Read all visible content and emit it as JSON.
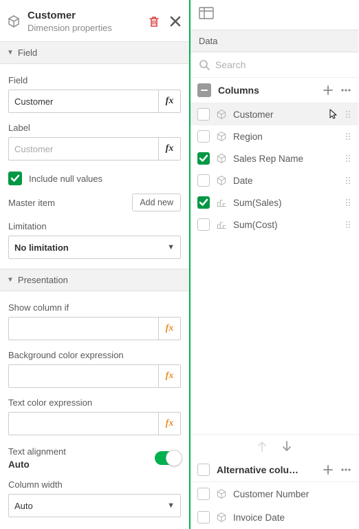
{
  "header": {
    "title": "Customer",
    "subtitle": "Dimension properties"
  },
  "sections": {
    "field": "Field",
    "presentation": "Presentation"
  },
  "field": {
    "label": "Field",
    "value": "Customer",
    "label_label": "Label",
    "label_placeholder": "Customer",
    "include_null": "Include null values",
    "master_item": "Master item",
    "add_new": "Add new",
    "limitation_label": "Limitation",
    "limitation_value": "No limitation"
  },
  "presentation": {
    "show_if": "Show column if",
    "bg_expr": "Background color expression",
    "text_expr": "Text color expression",
    "text_align_label": "Text alignment",
    "text_align_value": "Auto",
    "col_width_label": "Column width",
    "col_width_value": "Auto"
  },
  "right": {
    "data": "Data",
    "search_placeholder": "Search",
    "columns_title": "Columns",
    "columns": [
      {
        "name": "Customer",
        "type": "dim",
        "checked": false,
        "hovered": true
      },
      {
        "name": "Region",
        "type": "dim",
        "checked": false
      },
      {
        "name": "Sales Rep Name",
        "type": "dim",
        "checked": true
      },
      {
        "name": "Date",
        "type": "dim",
        "checked": false
      },
      {
        "name": "Sum(Sales)",
        "type": "measure",
        "checked": true
      },
      {
        "name": "Sum(Cost)",
        "type": "measure",
        "checked": false
      }
    ],
    "alt_title": "Alternative colu…",
    "alt_columns": [
      {
        "name": "Customer Number",
        "type": "dim"
      },
      {
        "name": "Invoice Date",
        "type": "dim"
      }
    ]
  },
  "fx": "fx"
}
